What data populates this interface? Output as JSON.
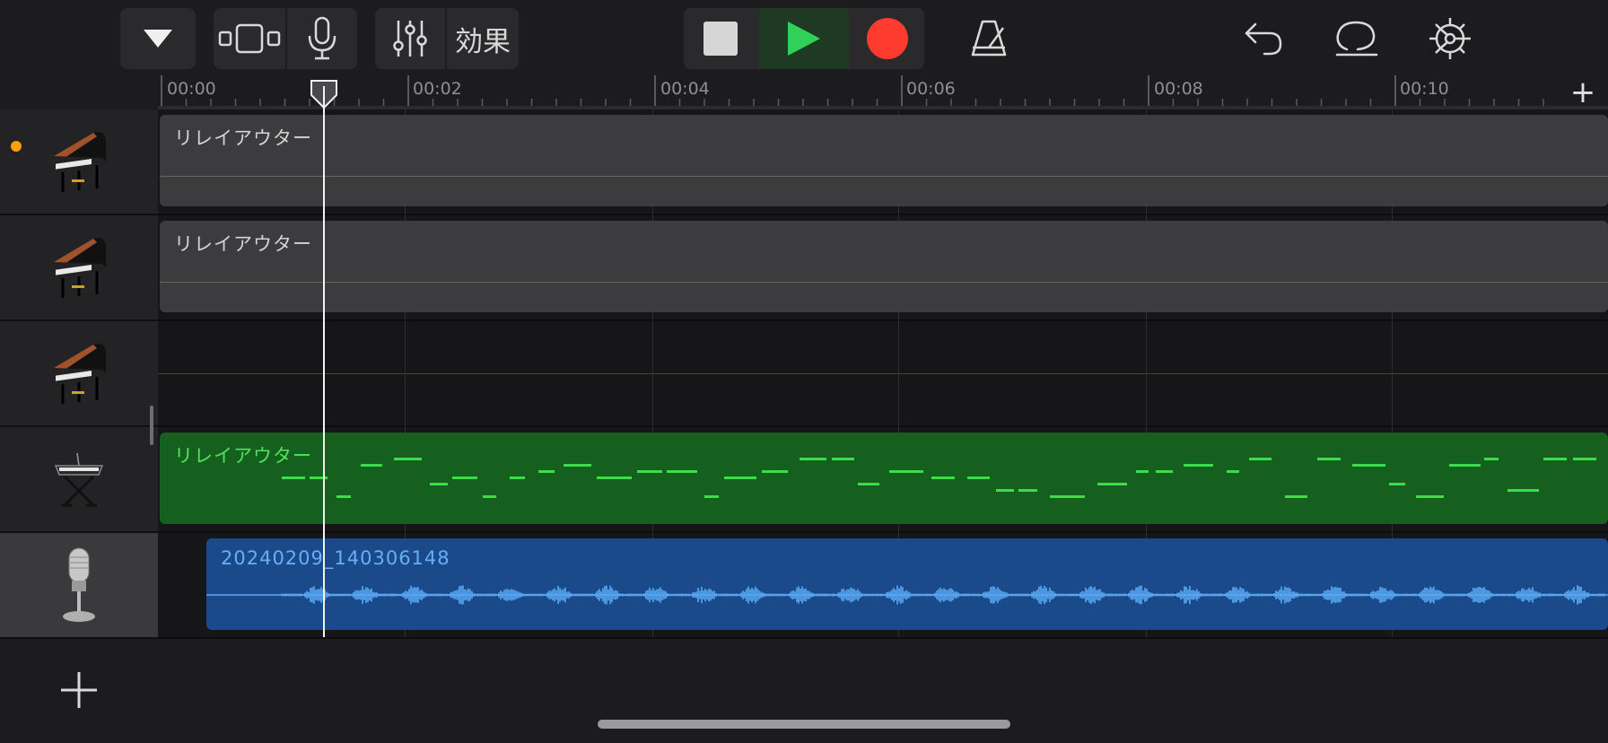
{
  "toolbar": {
    "tracks_view_icon": "triangle-down-icon",
    "mode_icon": "track-view-toggle-icon",
    "mic_icon": "microphone-icon",
    "mixer_icon": "sliders-icon",
    "effects_label": "効果",
    "stop_icon": "stop-icon",
    "play_icon": "play-icon",
    "record_icon": "record-icon",
    "metronome_icon": "metronome-icon",
    "undo_icon": "undo-icon",
    "loop_icon": "loop-browser-icon",
    "settings_icon": "gear-icon"
  },
  "ruler": {
    "ticks": [
      "00:00",
      "00:02",
      "00:04",
      "00:06",
      "00:08",
      "00:10"
    ],
    "add_section": "+"
  },
  "tracks": [
    {
      "instrument": "grand-piano-icon",
      "region_label": "リレイアウター",
      "region_color": "gray",
      "armed": true
    },
    {
      "instrument": "grand-piano-icon",
      "region_label": "リレイアウター",
      "region_color": "gray"
    },
    {
      "instrument": "grand-piano-icon",
      "region_label": "",
      "region_color": "none"
    },
    {
      "instrument": "keyboard-stand-icon",
      "region_label": "リレイアウター",
      "region_color": "green"
    },
    {
      "instrument": "microphone-stand-icon",
      "region_label": "20240209_140306148",
      "region_color": "blue",
      "selected": true
    }
  ],
  "add_track_label": "+",
  "colors": {
    "play": "#30d158",
    "record": "#ff3b30",
    "midi_region": "#155f1f",
    "midi_note": "#3ddc4a",
    "audio_region": "#1a4a8a",
    "audio_wave": "#5aa9f5",
    "armed_dot": "#ff9f0a"
  }
}
